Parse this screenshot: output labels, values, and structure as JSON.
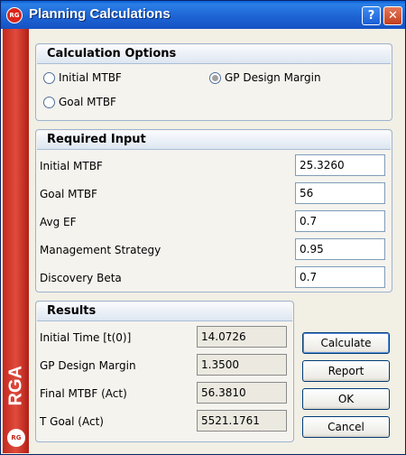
{
  "window": {
    "title": "Planning Calculations",
    "logo": "RG",
    "help_label": "?",
    "close_label": "✕"
  },
  "sidebar": {
    "brand": "RGA",
    "logo": "RG"
  },
  "calculation_options": {
    "header": "Calculation Options",
    "options": [
      {
        "label": "Initial MTBF",
        "selected": false
      },
      {
        "label": "GP Design Margin",
        "selected": true
      },
      {
        "label": "Goal MTBF",
        "selected": false
      }
    ]
  },
  "required_input": {
    "header": "Required Input",
    "fields": [
      {
        "label": "Initial MTBF",
        "value": "25.3260"
      },
      {
        "label": "Goal MTBF",
        "value": "56"
      },
      {
        "label": "Avg EF",
        "value": "0.7"
      },
      {
        "label": "Management Strategy",
        "value": "0.95"
      },
      {
        "label": "Discovery Beta",
        "value": "0.7"
      }
    ]
  },
  "results": {
    "header": "Results",
    "fields": [
      {
        "label": "Initial Time [t(0)]",
        "value": "14.0726"
      },
      {
        "label": "GP Design Margin",
        "value": "1.3500"
      },
      {
        "label": "Final MTBF (Act)",
        "value": "56.3810"
      },
      {
        "label": "T Goal (Act)",
        "value": "5521.1761"
      }
    ]
  },
  "buttons": {
    "calculate": "Calculate",
    "report": "Report",
    "ok": "OK",
    "cancel": "Cancel"
  }
}
